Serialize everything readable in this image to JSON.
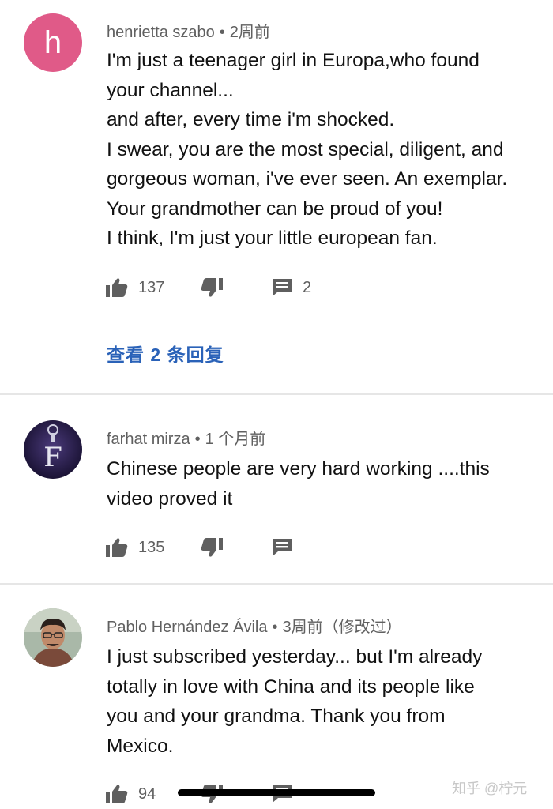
{
  "comments": [
    {
      "author": "henrietta szabo",
      "time": "2周前",
      "avatar_letter": "h",
      "avatar_color": "#e05a88",
      "lines": [
        "I'm just a teenager girl in Europa,who found",
        "your channel...",
        "and after, every time i'm shocked.",
        "I swear, you are the most special, diligent, and",
        "gorgeous woman, i've ever seen. An exemplar.",
        "Your grandmother can be proud of you!",
        "I think, I'm just your little european fan."
      ],
      "likes": "137",
      "reply_count": "2",
      "view_replies": "查看 2 条回复"
    },
    {
      "author": "farhat mirza",
      "time": "1 个月前",
      "avatar_letter": "F",
      "lines": [
        "Chinese people are very hard working ....this",
        "video proved it"
      ],
      "likes": "135"
    },
    {
      "author": "Pablo Hernández Ávila",
      "time": "3周前（修改过）",
      "lines": [
        "I just subscribed yesterday... but I'm already",
        "totally in love with China and its people like",
        "you and your grandma. Thank you from",
        "Mexico."
      ],
      "likes": "94"
    }
  ],
  "separator": "•",
  "watermark": "知乎 @柠元",
  "icons": {
    "like": "thumbs-up-icon",
    "dislike": "thumbs-down-icon",
    "reply": "comment-icon"
  },
  "colors": {
    "link": "#2a62b8",
    "meta": "#606060",
    "divider": "#e6e6e6"
  }
}
